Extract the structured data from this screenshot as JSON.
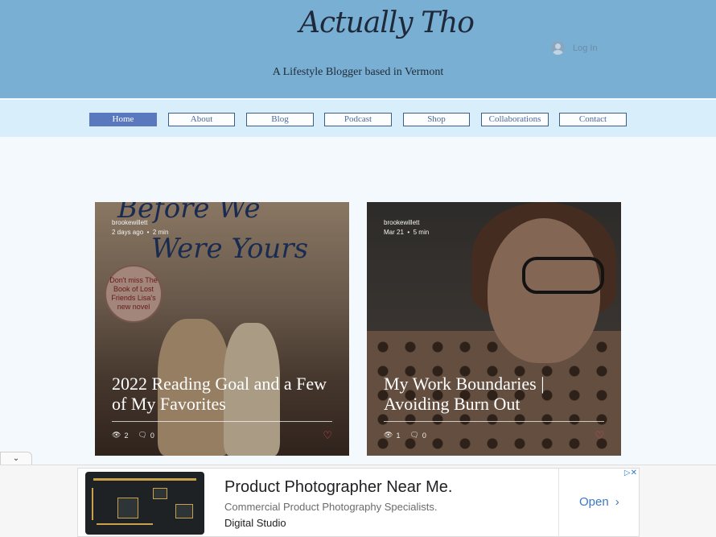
{
  "header": {
    "logo_text": "Actually Tho",
    "tagline": "A Lifestyle Blogger based in Vermont",
    "login_label": "Log In"
  },
  "nav": {
    "items": [
      "Home",
      "About",
      "Blog",
      "Podcast",
      "Shop",
      "Collaborations",
      "Contact"
    ],
    "active": "Home"
  },
  "posts": [
    {
      "author": "brookewillett",
      "date": "2 days ago",
      "read_time": "2 min",
      "title": "2022 Reading Goal and a Few of My Favorites",
      "views": "2",
      "comments": "0",
      "image_text": {
        "book_title_line1": "Before We",
        "book_title_line2": "Were Yours",
        "sticker": "Don't miss The Book of Lost Friends Lisa's new novel"
      }
    },
    {
      "author": "brookewillett",
      "date": "Mar 21",
      "read_time": "5 min",
      "title": "My Work Boundaries | Avoiding Burn Out",
      "views": "1",
      "comments": "0"
    }
  ],
  "ad": {
    "title": "Product Photographer Near Me.",
    "description": "Commercial Product Photography Specialists.",
    "advertiser": "Digital Studio",
    "cta": "Open",
    "choices_icon": "ad-choices-icon",
    "collapse_icon": "chevron-down-icon"
  },
  "colors": {
    "header_bg": "#7aafd4",
    "nav_bg": "#d8eefb",
    "nav_active": "#5a78be",
    "page_bg": "#f3f9fd",
    "heart": "#e24c52",
    "ad_link": "#3b78c4"
  }
}
